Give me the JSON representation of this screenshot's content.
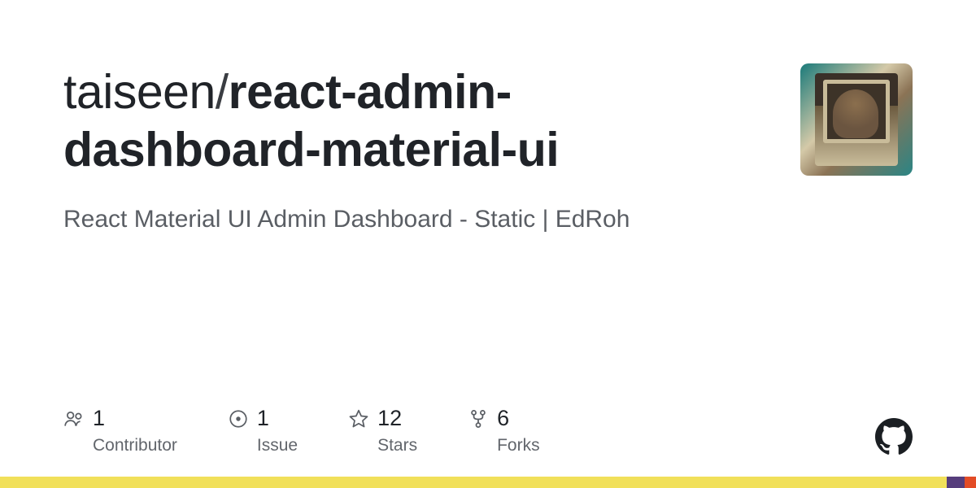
{
  "repo": {
    "owner": "taiseen",
    "separator": "/",
    "name_part1": "react",
    "name_part2": "-admin-",
    "name_part3": "dashboard",
    "name_part4": "-material-ui"
  },
  "description": "React Material UI Admin Dashboard - Static | EdRoh",
  "stats": {
    "contributors": {
      "value": "1",
      "label": "Contributor"
    },
    "issues": {
      "value": "1",
      "label": "Issue"
    },
    "stars": {
      "value": "12",
      "label": "Stars"
    },
    "forks": {
      "value": "6",
      "label": "Forks"
    }
  }
}
